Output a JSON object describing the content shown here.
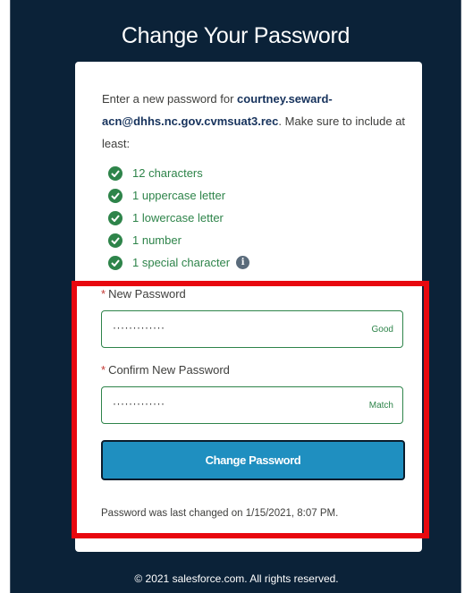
{
  "page": {
    "title": "Change Your Password"
  },
  "intro": {
    "prefix": "Enter a new password for ",
    "username": "courtney.seward-acn@dhhs.nc.gov.cvmsuat3.rec",
    "suffix": ". Make sure to include at least:"
  },
  "requirements": [
    {
      "label": "12 characters"
    },
    {
      "label": "1 uppercase letter"
    },
    {
      "label": "1 lowercase letter"
    },
    {
      "label": "1 number"
    },
    {
      "label": "1 special character"
    }
  ],
  "form": {
    "required_marker": "*",
    "new_password": {
      "label": "New Password",
      "value": "·············",
      "strength": "Good"
    },
    "confirm_password": {
      "label": "Confirm New Password",
      "value": "·············",
      "status": "Match"
    },
    "submit_label": "Change Password"
  },
  "last_changed": "Password was last changed on 1/15/2021, 8:07 PM.",
  "footer": {
    "copyright": "© 2021 salesforce.com. All rights reserved."
  },
  "colors": {
    "background": "#0b2238",
    "accent": "#1f8fc0",
    "success": "#2e844a",
    "highlight": "#e8080f"
  },
  "icons": {
    "requirement": "check-circle-icon",
    "special_char_help": "info-icon"
  }
}
